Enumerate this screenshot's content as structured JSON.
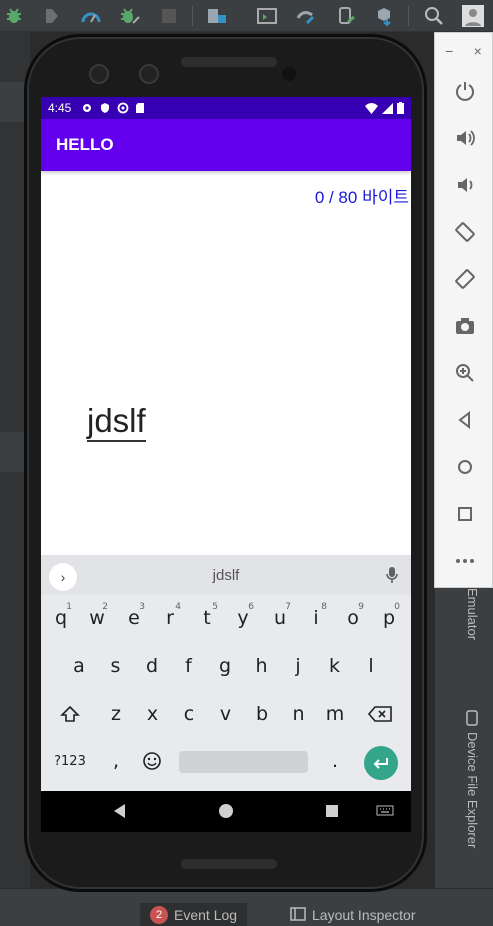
{
  "app": {
    "title": "HELLO"
  },
  "statusbar": {
    "time": "4:45"
  },
  "main": {
    "byte_counter": "0 / 80 바이트",
    "input_value": "jdslf"
  },
  "keyboard": {
    "suggestion": "jdslf",
    "row1": [
      {
        "label": "q",
        "hint": "1"
      },
      {
        "label": "w",
        "hint": "2"
      },
      {
        "label": "e",
        "hint": "3"
      },
      {
        "label": "r",
        "hint": "4"
      },
      {
        "label": "t",
        "hint": "5"
      },
      {
        "label": "y",
        "hint": "6"
      },
      {
        "label": "u",
        "hint": "7"
      },
      {
        "label": "i",
        "hint": "8"
      },
      {
        "label": "o",
        "hint": "9"
      },
      {
        "label": "p",
        "hint": "0"
      }
    ],
    "row2": [
      "a",
      "s",
      "d",
      "f",
      "g",
      "h",
      "j",
      "k",
      "l"
    ],
    "row3": [
      "z",
      "x",
      "c",
      "v",
      "b",
      "n",
      "m"
    ],
    "symbols_label": "?123",
    "comma_label": ",",
    "period_label": "."
  },
  "ide": {
    "side_tabs": {
      "emulator": "Emulator",
      "device_explorer": "Device File Explorer"
    },
    "bottom_tabs": {
      "event_log": "Event Log",
      "event_log_count": "2",
      "layout_inspector": "Layout Inspector"
    }
  },
  "emulator_panel": {
    "controls": [
      "power-icon",
      "volume-up-icon",
      "volume-down-icon",
      "rotate-left-icon",
      "rotate-right-icon",
      "camera-icon",
      "zoom-icon",
      "back-icon",
      "home-icon",
      "overview-icon",
      "more-icon"
    ]
  },
  "colors": {
    "app_bar": "#6200ee",
    "status_bar": "#3700b3",
    "byte_counter": "#1a1ad6",
    "enter_key": "#33a58b"
  }
}
